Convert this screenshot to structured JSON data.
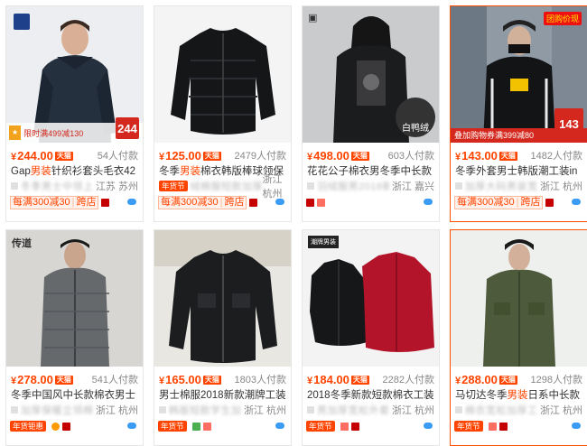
{
  "products": [
    {
      "price": "244.00",
      "sales": "54人付款",
      "title_a": "Gap",
      "title_hl": "男装",
      "title_b": "针织衫套头毛衣427930",
      "title_c": "冬季男士中领上衣打底衫",
      "location": "江苏 苏州",
      "promo": [
        "每满300减30",
        "跨店"
      ],
      "overlay_tag": "限时满499减130",
      "overlay_price": "244"
    },
    {
      "price": "125.00",
      "sales": "2479人付款",
      "title_a": "冬季",
      "title_hl": "男装",
      "title_b": "棉衣韩版棒球领保暖羽",
      "title_c": "绒棉服短款加厚加大码外套",
      "location": "浙江 杭州",
      "badge": "年货节",
      "promo": [
        "每满300减30",
        "跨店"
      ]
    },
    {
      "price": "498.00",
      "sales": "603人付款",
      "title_a": "花花公子棉衣男冬季中长款男士",
      "title_hl": "",
      "title_b": "",
      "title_c": "羽绒服男2018新款加厚外套",
      "location": "浙江 嘉兴",
      "overlay_corner": "白鸭绒"
    },
    {
      "price": "143.00",
      "sales": "1482人付款",
      "title_a": "冬季外套男士韩版潮工装ins棉衣",
      "title_hl": "",
      "title_b": "",
      "title_c": "加厚大码男装宽松连帽棉服",
      "location": "浙江 杭州",
      "promo": [
        "每满300减30",
        "跨店"
      ],
      "overlay_tag": "叠加购物券满399减80",
      "overlay_corner": "团购价现",
      "overlay_price": "143",
      "overlay_sub": "年货价"
    },
    {
      "price": "278.00",
      "sales": "541人付款",
      "title_a": "冬季中国风中长款棉衣男士外套",
      "title_hl": "",
      "title_b": "",
      "title_c": "加厚保暖立领棉服男",
      "location": "浙江 杭州",
      "badge": "年货钜惠",
      "overlay_logo": "传道"
    },
    {
      "price": "165.00",
      "sales": "1803人付款",
      "title_a": "男士棉服2018新款潮牌工装棉衣",
      "title_hl": "",
      "title_b": "",
      "title_c": "韩版短款学生加厚外套",
      "location": "浙江 杭州",
      "badge": "年货节"
    },
    {
      "price": "184.00",
      "sales": "2282人付款",
      "title_a": "2018冬季新款短款棉衣工装棉服",
      "title_hl": "",
      "title_b": "",
      "title_c": "男加厚宽松外套",
      "location": "浙江 杭州",
      "badge": "年货节",
      "overlay_logo": "潮牌男装"
    },
    {
      "price": "288.00",
      "sales": "1298人付款",
      "title_a": "马切达冬季",
      "title_hl": "男装",
      "title_b": "日系中长款连帽",
      "title_c": "棉衣宽松加厚工装棉服",
      "location": "浙江 杭州",
      "badge": "年货节"
    }
  ],
  "currency": "¥",
  "mall_tag": "天猫"
}
